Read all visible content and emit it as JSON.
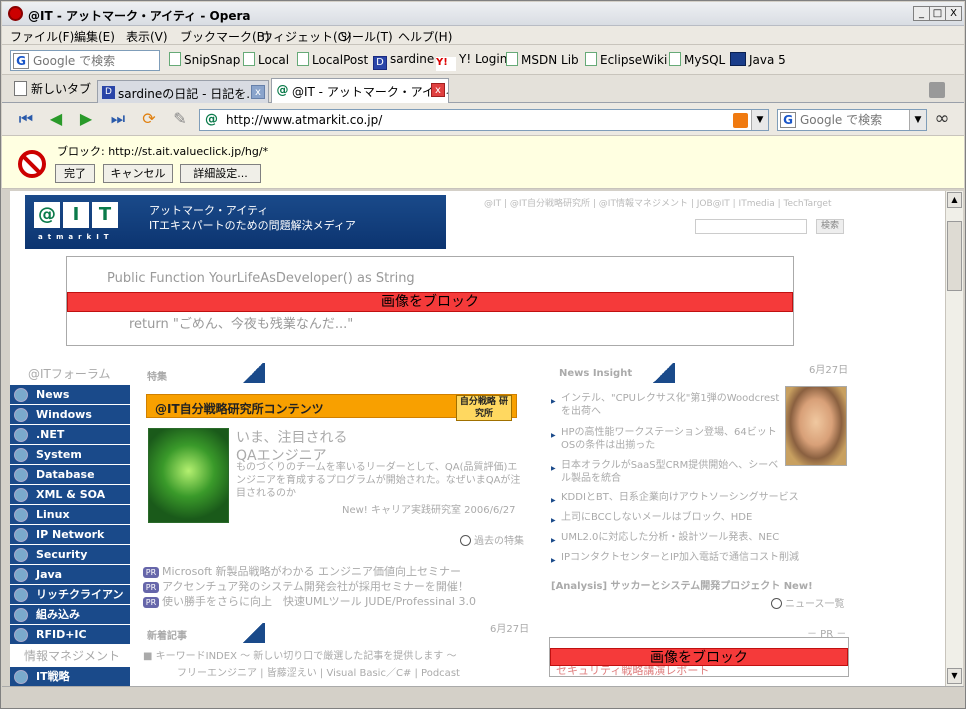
{
  "window": {
    "title": "@IT - アットマーク・アイティ - Opera",
    "btn_min": "_",
    "btn_max": "□",
    "btn_close": "X"
  },
  "menu": [
    "ファイル(F)",
    "編集(E)",
    "表示(V)",
    "ブックマーク(B)",
    "ウィジェット(G)",
    "ツール(T)",
    "ヘルプ(H)"
  ],
  "bookmarks": {
    "search_placeholder": "Google で検索",
    "items": [
      "SnipSnap",
      "Local",
      "LocalPost",
      "sardine",
      "Y! Login",
      "MSDN Lib",
      "EclipseWiki",
      "MySQL",
      "Java 5"
    ],
    "sardine_icon": "D",
    "yahoo_icon": "Y!"
  },
  "tabs": {
    "new_tab": "新しいタブ",
    "tab1": "sardineの日記 - 日記を....",
    "tab2": "@IT - アットマーク・アイティ",
    "favicon_d": "D",
    "favicon_at": "@",
    "close": "x"
  },
  "address": {
    "url": "http://www.atmarkit.co.jp/",
    "site_icon": "@",
    "search_placeholder": "Google で検索",
    "dropdown": "▼"
  },
  "blocker": {
    "text": "ブロック: http://st.ait.valueclick.jp/hg/*",
    "btn_done": "完了",
    "btn_cancel": "キャンセル",
    "btn_details": "詳細設定..."
  },
  "page": {
    "logo_letters": [
      "@",
      "I",
      "T"
    ],
    "logo_sub": "atmarkIT",
    "logo_title": "アットマーク・アイティ",
    "logo_tagline": "ITエキスパートのための問題解決メディア",
    "top_links": "@IT | @IT自分戦略研究所 | @IT情報マネジメント | JOB@IT | ITmedia | TechTarget",
    "site_search_btn": "検索",
    "ad_line1": "Public Function  YourLifeAsDeveloper()  as String",
    "ad_line2": "return  \"ごめん、今夜も残業なんだ...\"",
    "blocked_label": "画像をブロック",
    "forum_head": "@ITフォーラム",
    "nav": [
      "News",
      "Windows",
      ".NET",
      "System",
      "Database",
      "XML & SOA",
      "Linux",
      "IP Network",
      "Security",
      "Java",
      "リッチクライアント",
      "組み込み",
      "RFID+IC"
    ],
    "info_head": "情報マネジメント",
    "nav2": [
      "IT戦略"
    ],
    "feature_head": "特集",
    "banner": "@IT自分戦略研究所コンテンツ",
    "banner_badge": "自分戦略 研究所",
    "feat_title1": "いま、注目される",
    "feat_title2": "QAエンジニア",
    "feat_desc": "ものづくりのチームを率いるリーダーとして、QA(品質評価)エンジニアを育成するプログラムが開始された。なぜいまQAが注目されるのか",
    "feat_source": "New! キャリア実践研究室 2006/6/27",
    "past_features": "過去の特集",
    "pr_tag": "PR",
    "pr_items": [
      "Microsoft 新製品戦略がわかる エンジニア価値向上セミナー",
      "アクセンチュア発のシステム開発会社が採用セミナーを開催！",
      "使い勝手をさらに向上　快速UMLツール JUDE/Professinal 3.0"
    ],
    "new_head": "新着記事",
    "new_date": "6月27日",
    "new_line1": "■ キーワードINDEX 〜 新しい切り口で厳選した記事を提供します 〜",
    "new_line2": "フリーエンジニア | 皆藤涩えい | Visual Basic／C# | Podcast",
    "news_head": "News Insight",
    "news_date": "6月27日",
    "news": [
      "インテル、\"CPUレクサス化\"第1弾のWoodcrestを出荷へ",
      "HPの高性能ワークステーション登場、64ビットOSの条件は出揃った",
      "日本オラクルがSaaS型CRM提供開始へ、シーベル製品を統合",
      "KDDIとBT、日系企業向けアウトソーシングサービス",
      "上司にBCCしないメールはブロック、HDE",
      "UML2.0に対応した分析・設計ツール発表、NEC",
      "IPコンタクトセンターとIP加入電話で通信コスト削減"
    ],
    "analysis": "[Analysis] サッカーとシステム開発プロジェクト New!",
    "news_more": "ニュース一覧",
    "pr_label": "－ PR －",
    "pr_box_text": "セキュリティ戦略講演レポート"
  },
  "colors": {
    "brand_blue": "#1a4a8a",
    "block_red": "#f53a3a",
    "banner_orange": "#f8a000"
  }
}
